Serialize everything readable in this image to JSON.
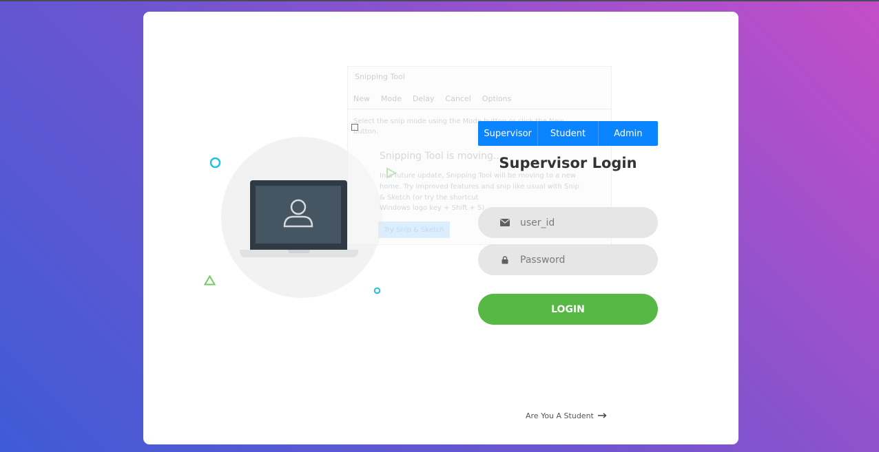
{
  "role_tabs": [
    {
      "label": "Supervisor"
    },
    {
      "label": "Student"
    },
    {
      "label": "Admin"
    }
  ],
  "login": {
    "title": "Supervisor Login",
    "user_placeholder": "user_id",
    "password_placeholder": "Password",
    "button_label": "LOGIN",
    "switch_link": "Are You A Student"
  },
  "overlay": {
    "window_title": "Snipping Tool",
    "toolbar": [
      "New",
      "Mode",
      "Delay",
      "Cancel",
      "Options"
    ],
    "instruction_1": "Select the snip mode using the Mode button or click the New",
    "instruction_2": "button.",
    "heading": "Snipping Tool is moving...",
    "body_1": "In a future update, Snipping Tool will be moving to a new",
    "body_2": "home. Try improved features and snip like usual with Snip",
    "body_3": "& Sketch (or try the shortcut",
    "body_4": "Windows logo key + Shift + S).",
    "try_button": "Try Snip & Sketch"
  },
  "icons": {
    "user": "user-icon",
    "email": "envelope-icon",
    "lock": "lock-icon",
    "arrow": "arrow-right-icon"
  },
  "colors": {
    "tab_blue": "#0b84ff",
    "login_green": "#57b846",
    "field_bg": "#e6e6e6"
  }
}
